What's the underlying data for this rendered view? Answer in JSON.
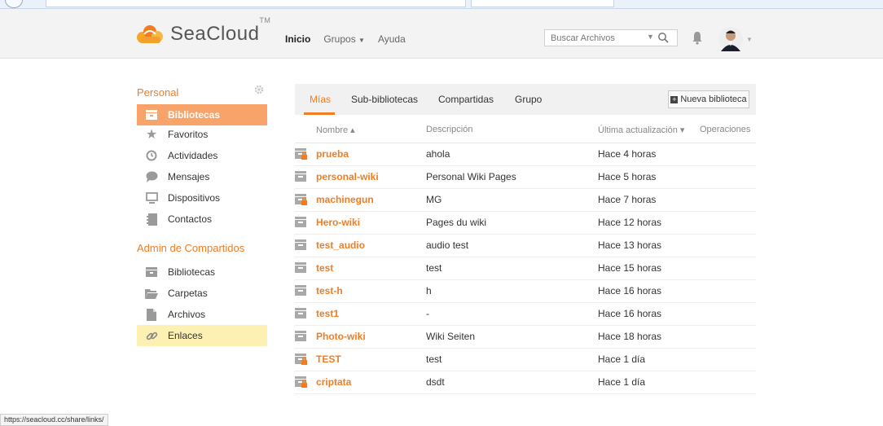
{
  "brand": {
    "name": "SeaCloud",
    "tm": "TM",
    "accent": "#f07d24",
    "highlight": "#fdf0b3",
    "active_bg": "#f8a36a"
  },
  "nav": {
    "inicio": "Inicio",
    "grupos": "Grupos",
    "ayuda": "Ayuda"
  },
  "search": {
    "placeholder": "Buscar Archivos"
  },
  "sidebar": {
    "personal_heading": "Personal",
    "personal_items": [
      {
        "label": "Bibliotecas",
        "icon": "library-icon"
      },
      {
        "label": "Favoritos",
        "icon": "star-icon"
      },
      {
        "label": "Actividades",
        "icon": "clock-icon"
      },
      {
        "label": "Mensajes",
        "icon": "chat-icon"
      },
      {
        "label": "Dispositivos",
        "icon": "monitor-icon"
      },
      {
        "label": "Contactos",
        "icon": "contacts-icon"
      }
    ],
    "admin_heading": "Admin de Compartidos",
    "admin_items": [
      {
        "label": "Bibliotecas",
        "icon": "library-icon"
      },
      {
        "label": "Carpetas",
        "icon": "folder-icon"
      },
      {
        "label": "Archivos",
        "icon": "file-icon"
      },
      {
        "label": "Enlaces",
        "icon": "link-icon"
      }
    ]
  },
  "tabs": [
    "Mías",
    "Sub-bibliotecas",
    "Compartidas",
    "Grupo"
  ],
  "new_library": "Nueva biblioteca",
  "table": {
    "headers": {
      "name": "Nombre ▴",
      "description": "Descripción",
      "updated": "Última actualización ▾",
      "operations": "Operaciones"
    },
    "rows": [
      {
        "name": "prueba",
        "description": "ahola",
        "updated": "Hace 4 horas",
        "encrypted": true
      },
      {
        "name": "personal-wiki",
        "description": "Personal Wiki Pages",
        "updated": "Hace 5 horas",
        "encrypted": false
      },
      {
        "name": "machinegun",
        "description": "MG",
        "updated": "Hace 7 horas",
        "encrypted": true
      },
      {
        "name": "Hero-wiki",
        "description": "Pages du wiki",
        "updated": "Hace 12 horas",
        "encrypted": false
      },
      {
        "name": "test_audio",
        "description": "audio test",
        "updated": "Hace 13 horas",
        "encrypted": false
      },
      {
        "name": "test",
        "description": "test",
        "updated": "Hace 15 horas",
        "encrypted": false
      },
      {
        "name": "test-h",
        "description": "h",
        "updated": "Hace 16 horas",
        "encrypted": false
      },
      {
        "name": "test1",
        "description": "-",
        "updated": "Hace 16 horas",
        "encrypted": false
      },
      {
        "name": "Photo-wiki",
        "description": "Wiki Seiten",
        "updated": "Hace 18 horas",
        "encrypted": false
      },
      {
        "name": "TEST",
        "description": "test",
        "updated": "Hace 1 día",
        "encrypted": true
      },
      {
        "name": "criptata",
        "description": "dsdt",
        "updated": "Hace 1 día",
        "encrypted": true
      }
    ]
  },
  "status_url": "https://seacloud.cc/share/links/"
}
